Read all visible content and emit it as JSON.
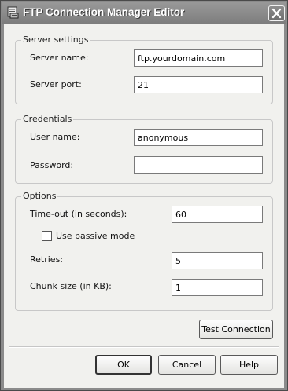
{
  "window": {
    "title": "FTP Connection Manager Editor"
  },
  "icons": {
    "app": "ftp-manager-icon",
    "close": "close-icon"
  },
  "server_settings": {
    "group_label": "Server settings",
    "server_name_label": "Server name:",
    "server_name_value": "ftp.yourdomain.com",
    "server_port_label": "Server port:",
    "server_port_value": "21"
  },
  "credentials": {
    "group_label": "Credentials",
    "user_name_label": "User name:",
    "user_name_value": "anonymous",
    "password_label": "Password:",
    "password_value": ""
  },
  "options": {
    "group_label": "Options",
    "timeout_label": "Time-out (in seconds):",
    "timeout_value": "60",
    "passive_label": "Use passive mode",
    "passive_checked": false,
    "retries_label": "Retries:",
    "retries_value": "5",
    "chunk_label": "Chunk size (in KB):",
    "chunk_value": "1"
  },
  "buttons": {
    "test_connection": "Test Connection",
    "ok": "OK",
    "cancel": "Cancel",
    "help": "Help"
  }
}
